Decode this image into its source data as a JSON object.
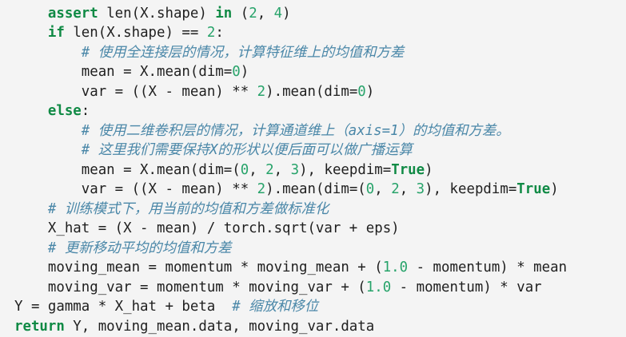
{
  "lines": [
    {
      "indent": "    ",
      "tokens": [
        {
          "t": "kw",
          "s": "assert"
        },
        {
          "t": "",
          "s": " len(X.shape) "
        },
        {
          "t": "kw",
          "s": "in"
        },
        {
          "t": "",
          "s": " ("
        },
        {
          "t": "num",
          "s": "2"
        },
        {
          "t": "",
          "s": ", "
        },
        {
          "t": "num",
          "s": "4"
        },
        {
          "t": "",
          "s": ")"
        }
      ]
    },
    {
      "indent": "    ",
      "tokens": [
        {
          "t": "kw",
          "s": "if"
        },
        {
          "t": "",
          "s": " len(X.shape) == "
        },
        {
          "t": "num",
          "s": "2"
        },
        {
          "t": "",
          "s": ":"
        }
      ]
    },
    {
      "indent": "        ",
      "tokens": [
        {
          "t": "cm",
          "s": "# 使用全连接层的情况，计算特征维上的均值和方差"
        }
      ]
    },
    {
      "indent": "        ",
      "tokens": [
        {
          "t": "",
          "s": "mean = X.mean(dim="
        },
        {
          "t": "num",
          "s": "0"
        },
        {
          "t": "",
          "s": ")"
        }
      ]
    },
    {
      "indent": "        ",
      "tokens": [
        {
          "t": "",
          "s": "var = ((X - mean) ** "
        },
        {
          "t": "num",
          "s": "2"
        },
        {
          "t": "",
          "s": ").mean(dim="
        },
        {
          "t": "num",
          "s": "0"
        },
        {
          "t": "",
          "s": ")"
        }
      ]
    },
    {
      "indent": "    ",
      "tokens": [
        {
          "t": "kw",
          "s": "else"
        },
        {
          "t": "",
          "s": ":"
        }
      ]
    },
    {
      "indent": "        ",
      "tokens": [
        {
          "t": "cm",
          "s": "# 使用二维卷积层的情况，计算通道维上（axis=1）的均值和方差。"
        }
      ]
    },
    {
      "indent": "        ",
      "tokens": [
        {
          "t": "cm",
          "s": "# 这里我们需要保持X的形状以便后面可以做广播运算"
        }
      ]
    },
    {
      "indent": "        ",
      "tokens": [
        {
          "t": "",
          "s": "mean = X.mean(dim=("
        },
        {
          "t": "num",
          "s": "0"
        },
        {
          "t": "",
          "s": ", "
        },
        {
          "t": "num",
          "s": "2"
        },
        {
          "t": "",
          "s": ", "
        },
        {
          "t": "num",
          "s": "3"
        },
        {
          "t": "",
          "s": "), keepdim="
        },
        {
          "t": "kw",
          "s": "True"
        },
        {
          "t": "",
          "s": ")"
        }
      ]
    },
    {
      "indent": "        ",
      "tokens": [
        {
          "t": "",
          "s": "var = ((X - mean) ** "
        },
        {
          "t": "num",
          "s": "2"
        },
        {
          "t": "",
          "s": ").mean(dim=("
        },
        {
          "t": "num",
          "s": "0"
        },
        {
          "t": "",
          "s": ", "
        },
        {
          "t": "num",
          "s": "2"
        },
        {
          "t": "",
          "s": ", "
        },
        {
          "t": "num",
          "s": "3"
        },
        {
          "t": "",
          "s": "), keepdim="
        },
        {
          "t": "kw",
          "s": "True"
        },
        {
          "t": "",
          "s": ")"
        }
      ]
    },
    {
      "indent": "    ",
      "tokens": [
        {
          "t": "cm",
          "s": "# 训练模式下，用当前的均值和方差做标准化"
        }
      ]
    },
    {
      "indent": "    ",
      "tokens": [
        {
          "t": "",
          "s": "X_hat = (X - mean) / torch.sqrt(var + eps)"
        }
      ]
    },
    {
      "indent": "    ",
      "tokens": [
        {
          "t": "cm",
          "s": "# 更新移动平均的均值和方差"
        }
      ]
    },
    {
      "indent": "    ",
      "tokens": [
        {
          "t": "",
          "s": "moving_mean = momentum * moving_mean + ("
        },
        {
          "t": "num",
          "s": "1.0"
        },
        {
          "t": "",
          "s": " - momentum) * mean"
        }
      ]
    },
    {
      "indent": "    ",
      "tokens": [
        {
          "t": "",
          "s": "moving_var = momentum * moving_var + ("
        },
        {
          "t": "num",
          "s": "1.0"
        },
        {
          "t": "",
          "s": " - momentum) * var"
        }
      ]
    },
    {
      "indent": "",
      "tokens": [
        {
          "t": "",
          "s": "Y = gamma * X_hat + beta  "
        },
        {
          "t": "cm",
          "s": "# 缩放和移位"
        }
      ]
    },
    {
      "indent": "",
      "tokens": [
        {
          "t": "kw",
          "s": "return"
        },
        {
          "t": "",
          "s": " Y, moving_mean.data, moving_var.data"
        }
      ]
    }
  ]
}
